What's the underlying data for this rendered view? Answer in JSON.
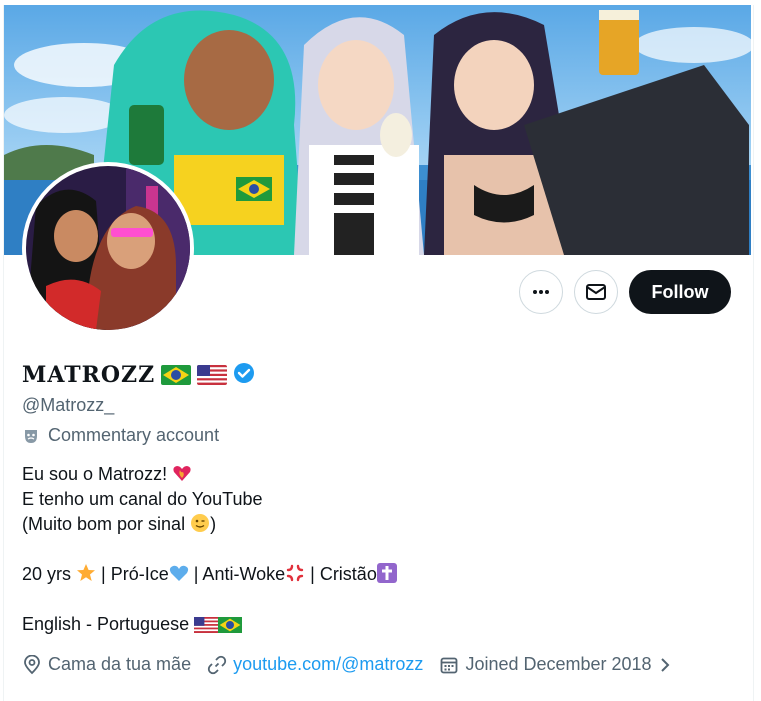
{
  "profile": {
    "display_name": "MATROZZ",
    "handle": "@Matrozz_",
    "category": "Commentary account",
    "bio_line1": "Eu sou o Matrozz!",
    "bio_line2": "E tenho um canal do YouTube",
    "bio_line3": "(Muito bom por sinal",
    "bio_line3_end": ")",
    "bio_line5_a": "20 yrs",
    "bio_line5_b": " |  Pró-Ice",
    "bio_line5_c": " |  Anti-Woke",
    "bio_line5_d": " | Cristão",
    "bio_line7": "English - Portuguese",
    "location": "Cama da tua mãe",
    "website": "youtube.com/@matrozz",
    "joined": "Joined December 2018"
  },
  "actions": {
    "more_icon": "more-icon",
    "message_icon": "mail-icon",
    "follow_label": "Follow"
  },
  "icons": [
    "verified-badge-icon",
    "flag-brazil-icon",
    "flag-usa-icon",
    "theater-mask-icon",
    "location-pin-icon",
    "link-icon",
    "calendar-icon",
    "chevron-right-icon"
  ],
  "colors": {
    "accent": "#1d9bf0",
    "text_primary": "#0f1419",
    "text_secondary": "#536471",
    "follow_bg": "#0f1419"
  }
}
